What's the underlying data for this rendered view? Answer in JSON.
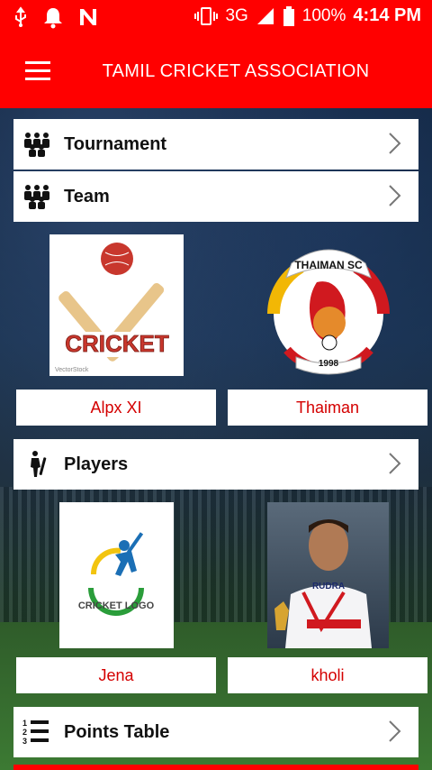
{
  "status_bar": {
    "network": "3G",
    "battery": "100%",
    "time": "4:14 PM"
  },
  "app_bar": {
    "title": "TAMIL CRICKET ASSOCIATION"
  },
  "menu": {
    "tournament": "Tournament",
    "team": "Team",
    "players": "Players",
    "points_table": "Points Table"
  },
  "teams": [
    {
      "name": "Alpx XI",
      "logo_text": "CRICKET",
      "logo_watermark": "VectorStock"
    },
    {
      "name": "Thaiman",
      "logo_text": "THAIMAN SC",
      "logo_year": "1998"
    }
  ],
  "players": [
    {
      "name": "Jena",
      "logo_text": "CRICKET LOGO"
    },
    {
      "name": "kholi",
      "shirt_text": "RUDRA"
    }
  ],
  "colors": {
    "accent": "#ff0000",
    "link_red": "#d40000"
  }
}
